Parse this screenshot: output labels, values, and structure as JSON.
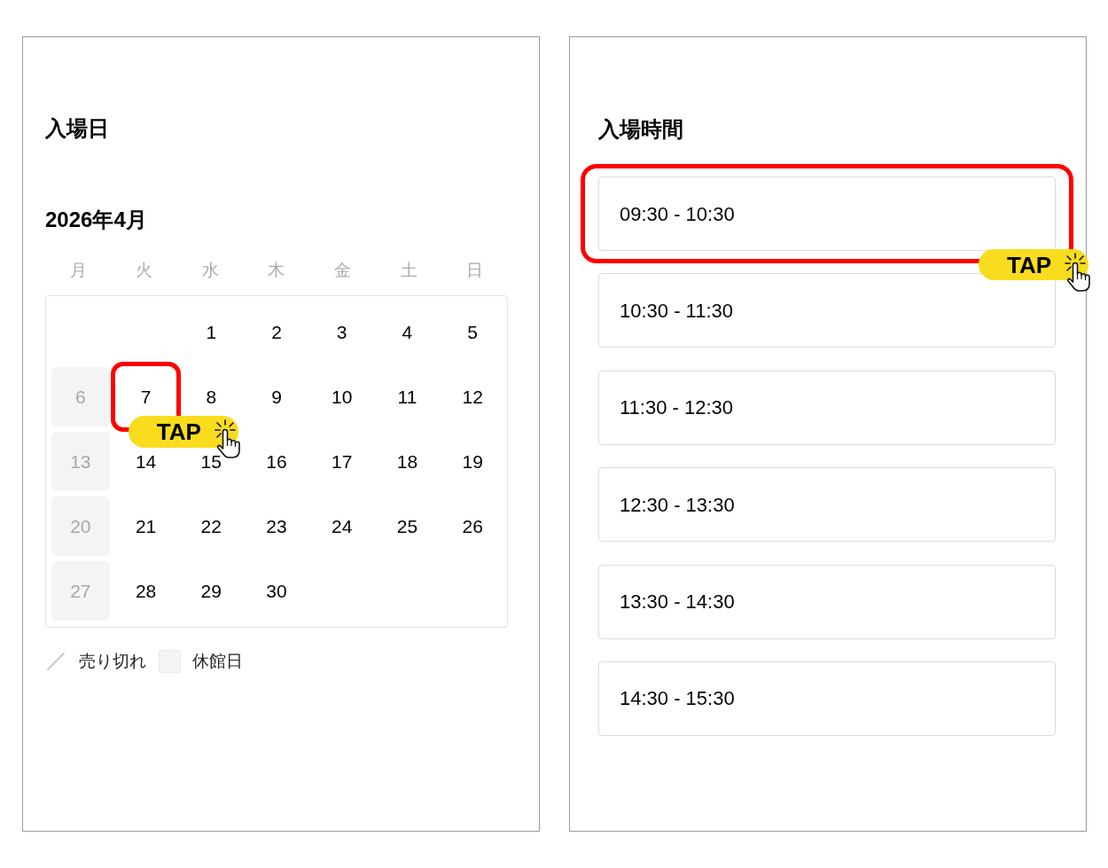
{
  "date_panel": {
    "title": "入場日",
    "month": "2026年4月",
    "weekdays": [
      "月",
      "火",
      "水",
      "木",
      "金",
      "土",
      "日"
    ],
    "weeks": [
      [
        {
          "kind": "blank"
        },
        {
          "kind": "blank"
        },
        {
          "kind": "day",
          "label": "1",
          "closed": false,
          "highlighted": false
        },
        {
          "kind": "day",
          "label": "2",
          "closed": false,
          "highlighted": false
        },
        {
          "kind": "day",
          "label": "3",
          "closed": false,
          "highlighted": false
        },
        {
          "kind": "day",
          "label": "4",
          "closed": false,
          "highlighted": false
        },
        {
          "kind": "day",
          "label": "5",
          "closed": false,
          "highlighted": false
        }
      ],
      [
        {
          "kind": "day",
          "label": "6",
          "closed": true,
          "highlighted": false
        },
        {
          "kind": "day",
          "label": "7",
          "closed": false,
          "highlighted": true
        },
        {
          "kind": "day",
          "label": "8",
          "closed": false,
          "highlighted": false
        },
        {
          "kind": "day",
          "label": "9",
          "closed": false,
          "highlighted": false
        },
        {
          "kind": "day",
          "label": "10",
          "closed": false,
          "highlighted": false
        },
        {
          "kind": "day",
          "label": "11",
          "closed": false,
          "highlighted": false
        },
        {
          "kind": "day",
          "label": "12",
          "closed": false,
          "highlighted": false
        }
      ],
      [
        {
          "kind": "day",
          "label": "13",
          "closed": true,
          "highlighted": false
        },
        {
          "kind": "day",
          "label": "14",
          "closed": false,
          "highlighted": false
        },
        {
          "kind": "day",
          "label": "15",
          "closed": false,
          "highlighted": false
        },
        {
          "kind": "day",
          "label": "16",
          "closed": false,
          "highlighted": false
        },
        {
          "kind": "day",
          "label": "17",
          "closed": false,
          "highlighted": false
        },
        {
          "kind": "day",
          "label": "18",
          "closed": false,
          "highlighted": false
        },
        {
          "kind": "day",
          "label": "19",
          "closed": false,
          "highlighted": false
        }
      ],
      [
        {
          "kind": "day",
          "label": "20",
          "closed": true,
          "highlighted": false
        },
        {
          "kind": "day",
          "label": "21",
          "closed": false,
          "highlighted": false
        },
        {
          "kind": "day",
          "label": "22",
          "closed": false,
          "highlighted": false
        },
        {
          "kind": "day",
          "label": "23",
          "closed": false,
          "highlighted": false
        },
        {
          "kind": "day",
          "label": "24",
          "closed": false,
          "highlighted": false
        },
        {
          "kind": "day",
          "label": "25",
          "closed": false,
          "highlighted": false
        },
        {
          "kind": "day",
          "label": "26",
          "closed": false,
          "highlighted": false
        }
      ],
      [
        {
          "kind": "day",
          "label": "27",
          "closed": true,
          "highlighted": false
        },
        {
          "kind": "day",
          "label": "28",
          "closed": false,
          "highlighted": false
        },
        {
          "kind": "day",
          "label": "29",
          "closed": false,
          "highlighted": false
        },
        {
          "kind": "day",
          "label": "30",
          "closed": false,
          "highlighted": false
        },
        {
          "kind": "blank"
        },
        {
          "kind": "blank"
        },
        {
          "kind": "blank"
        }
      ]
    ],
    "tap_hint": {
      "label": "TAP"
    },
    "legend": [
      {
        "kind": "sold_out",
        "label": "売り切れ"
      },
      {
        "kind": "closed",
        "label": "休館日"
      }
    ]
  },
  "time_panel": {
    "title": "入場時間",
    "slots": [
      {
        "label": "09:30 - 10:30",
        "highlighted": true
      },
      {
        "label": "10:30 - 11:30",
        "highlighted": false
      },
      {
        "label": "11:30 - 12:30",
        "highlighted": false
      },
      {
        "label": "12:30 - 13:30",
        "highlighted": false
      },
      {
        "label": "13:30 - 14:30",
        "highlighted": false
      },
      {
        "label": "14:30 - 15:30",
        "highlighted": false
      }
    ],
    "tap_hint": {
      "label": "TAP"
    }
  }
}
